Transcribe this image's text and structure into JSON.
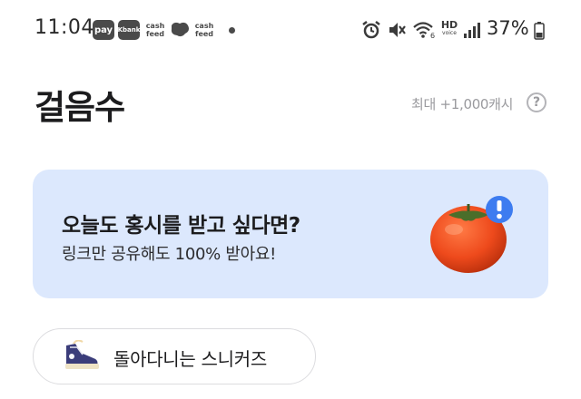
{
  "status_bar": {
    "time": "11:04",
    "pay_badge": "pay",
    "kbank_badge": "Kbank",
    "cashfeed_line1": "cash",
    "cashfeed_line2": "feed",
    "hd_label": "HD",
    "voice_label": "voice",
    "battery_percent": "37%"
  },
  "header": {
    "title": "걸음수",
    "max_reward": "최대 +1,000캐시",
    "help_icon": "?"
  },
  "banner": {
    "title": "오늘도 홍시를 받고 싶다면?",
    "subtitle": "링크만 공유해도 100% 받아요!",
    "icon": "persimmon-icon",
    "background_color": "#dce8fd",
    "badge_color": "#3d7cf0"
  },
  "chip": {
    "label": "돌아다니는 스니커즈",
    "icon": "sneaker-icon"
  }
}
